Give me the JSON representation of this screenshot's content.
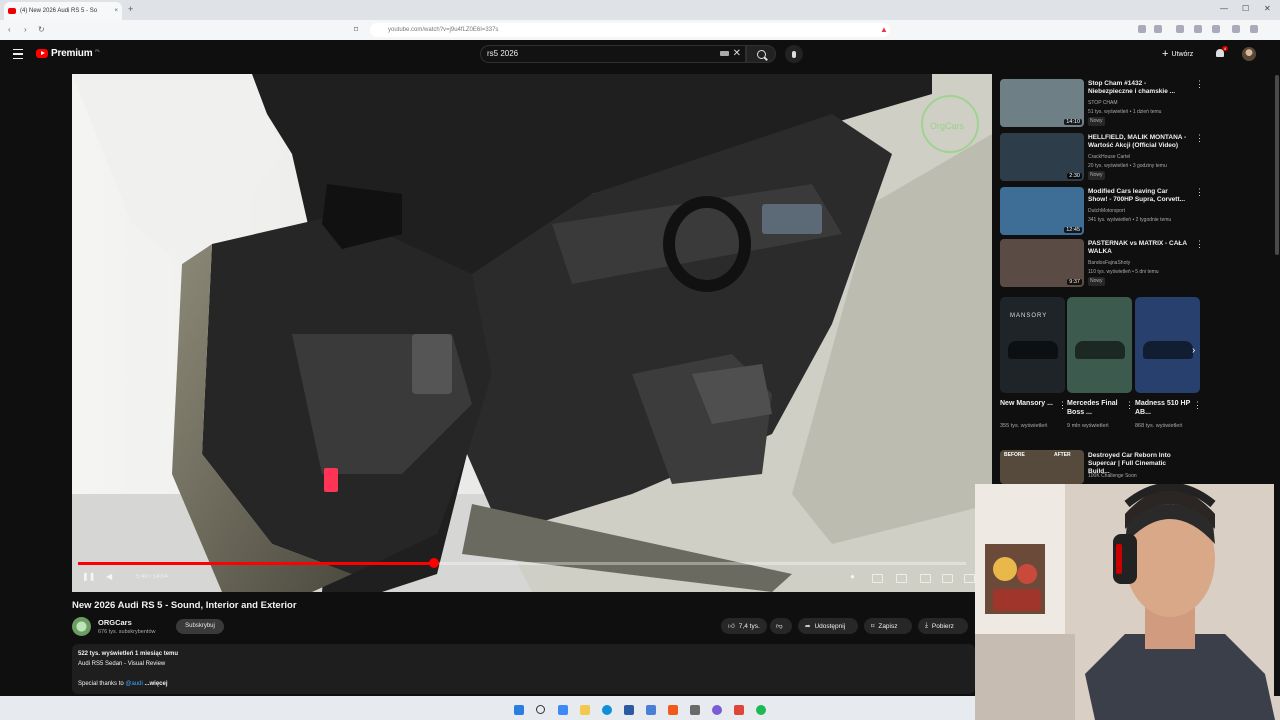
{
  "browser": {
    "tab_title": "(4) New 2026 Audi RS 5 - So",
    "tab_close": "×",
    "new_tab": "+",
    "url": "youtube.com/watch?v=j9u4fLZ0E6I=337s",
    "win_controls": [
      "—",
      "☐",
      "✕"
    ]
  },
  "header": {
    "logo_text": "Premium",
    "logo_sup": "PL",
    "search_value": "rs5 2026",
    "search_clear": "✕",
    "create_plus": "+",
    "create_label": "Utwórz",
    "notification_count": "4"
  },
  "player": {
    "time_text": "5:40 / 14:04",
    "progress_fraction": 0.401,
    "watermark_text": "OrgCars"
  },
  "video": {
    "title": "New 2026 Audi RS 5 - Sound, Interior and Exterior",
    "channel_name": "ORGCars",
    "channel_subs": "676 tys. subskrybentów",
    "subscribe_label": "Subskrybuj",
    "likes_label": "7,4 tys.",
    "share_label": "Udostępnij",
    "save_label": "Zapisz",
    "download_label": "Pobierz"
  },
  "description": {
    "stats": "522 tys. wyświetleń  1 miesiąc temu",
    "line1": "Audi RS5 Sedan - Visual Review",
    "thanks_prefix": "Special thanks to ",
    "thanks_link": "@audi",
    "more_label": " ...więcej"
  },
  "recommendations": [
    {
      "title": "Stop Cham #1432 - Niebezpieczne i chamskie ...",
      "channel": "STOP CHAM",
      "meta": "51 tys. wyświetleń • 1 dzień temu",
      "badge": "Nowy",
      "duration": "14:10",
      "thumb": "#6e7f86"
    },
    {
      "title": "HELLFIELD, MALIK MONTANA - Wartość Akcji (Official Video)",
      "channel": "CrackHouse Cartel",
      "meta": "20 tys. wyświetleń • 3 godziny temu",
      "badge": "Nowy",
      "duration": "2:30",
      "thumb": "#2d3e4a"
    },
    {
      "title": "Modified Cars leaving Car Show! - 700HP Supra, Corvett...",
      "channel": "DutchMotorsport",
      "meta": "341 tys. wyświetleń • 2 tygodnie temu",
      "badge": "",
      "duration": "12:45",
      "thumb": "#3e6d96"
    },
    {
      "title": "PASTERNAK vs MATRIX - CAŁA WALKA",
      "channel": "BandosFajnaShoty",
      "meta": "110 tys. wyświetleń • 5 dni temu",
      "badge": "Nowy",
      "duration": "9:37",
      "thumb": "#5a4b44"
    }
  ],
  "shorts": [
    {
      "title": "New Mansory ...",
      "meta": "355 tys. wyświetleń",
      "thumb": "#1e2428",
      "label": "MANSORY"
    },
    {
      "title": "Mercedes Final Boss ...",
      "meta": "9 mln wyświetleń",
      "thumb": "#3d5a4f",
      "label": ""
    },
    {
      "title": "Madness 510 HP AB...",
      "meta": "868 tys. wyświetleń",
      "thumb": "#27406e",
      "label": ""
    }
  ],
  "reco_last": {
    "title": "Destroyed Car Reborn Into Supercar | Full Cinematic Build...",
    "channel": "100K Challenge Soon",
    "thumb_before": "BEFORE",
    "thumb_after": "AFTER"
  },
  "colors": {
    "accent_red": "#ff0000",
    "page_bg": "#0f0f0f",
    "link_blue": "#3ea6ff"
  }
}
